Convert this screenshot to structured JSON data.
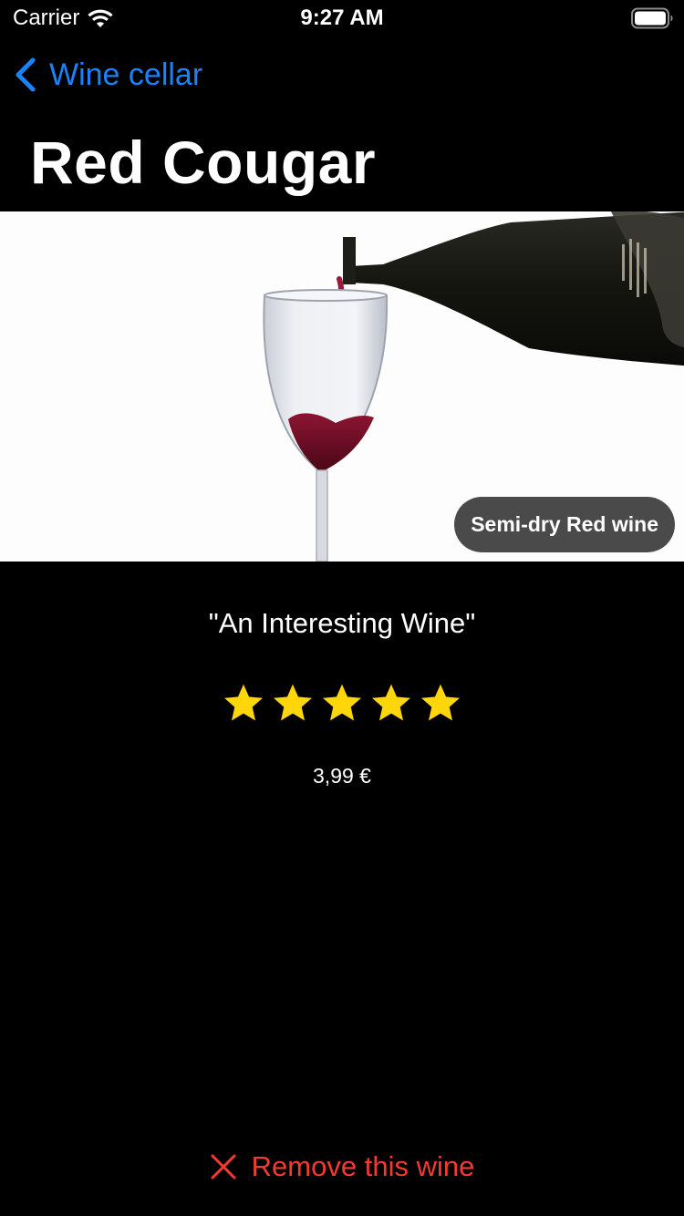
{
  "status_bar": {
    "carrier": "Carrier",
    "time": "9:27 AM",
    "wifi_icon": "wifi-icon",
    "battery_icon": "battery-icon"
  },
  "nav": {
    "back_label": "Wine cellar",
    "back_icon": "chevron-left-icon"
  },
  "wine": {
    "name": "Red Cougar",
    "type": "Semi-dry Red wine",
    "tagline": "\"An Interesting Wine\"",
    "rating": 5,
    "rating_max": 5,
    "price": "3,99 €"
  },
  "actions": {
    "remove_label": "Remove this wine",
    "remove_icon": "close-icon"
  },
  "colors": {
    "background": "#000000",
    "accent_blue": "#1a82fb",
    "destructive_red": "#f23b30",
    "star_yellow": "#ffd60a",
    "badge_background": "#4a4a4a"
  }
}
